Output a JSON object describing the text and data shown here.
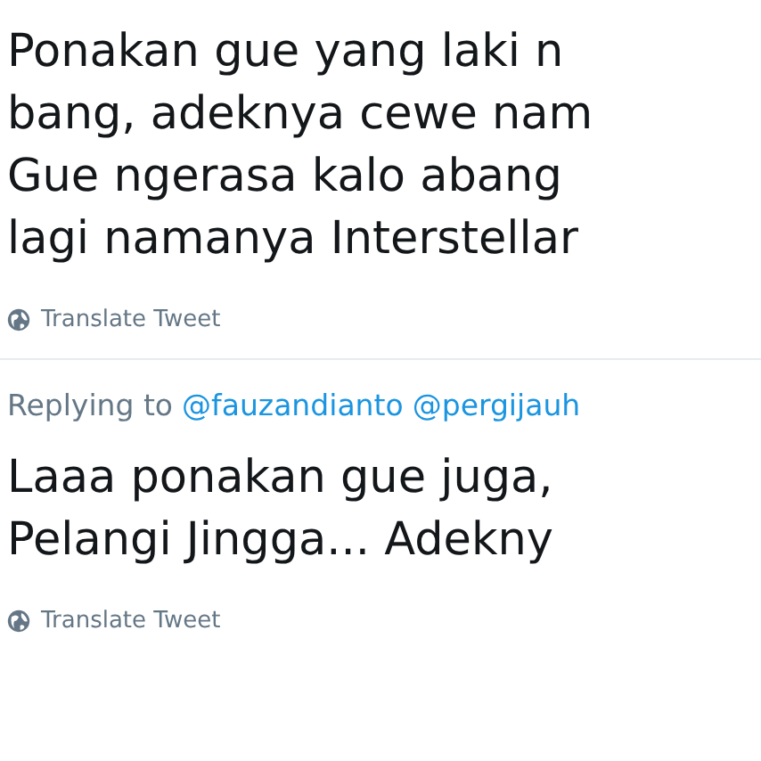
{
  "tweets": [
    {
      "lines": [
        "Ponakan gue yang laki n",
        "bang, adeknya cewe nam",
        "Gue ngerasa kalo abang",
        "lagi namanya Interstellar"
      ],
      "translate": "Translate Tweet"
    },
    {
      "replying": {
        "label": "Replying to",
        "mentions": [
          "@fauzandianto",
          "@pergijauh"
        ]
      },
      "lines": [
        "Laaa ponakan gue juga,",
        "Pelangi Jingga... Adekny"
      ],
      "translate": "Translate Tweet"
    }
  ]
}
